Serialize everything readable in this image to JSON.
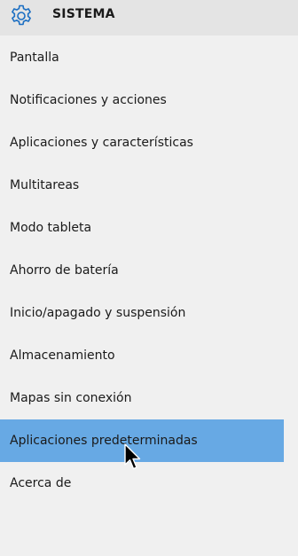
{
  "header": {
    "icon": "gear-icon",
    "title": "SISTEMA",
    "accent_color": "#1b6ec2"
  },
  "nav": {
    "selected_color": "#67a9e4",
    "items": [
      {
        "label": "Pantalla"
      },
      {
        "label": "Notificaciones y acciones"
      },
      {
        "label": "Aplicaciones y características"
      },
      {
        "label": "Multitareas"
      },
      {
        "label": "Modo tableta"
      },
      {
        "label": "Ahorro de batería"
      },
      {
        "label": "Inicio/apagado y suspensión"
      },
      {
        "label": "Almacenamiento"
      },
      {
        "label": "Mapas sin conexión"
      },
      {
        "label": "Aplicaciones predeterminadas",
        "selected": true
      },
      {
        "label": "Acerca de"
      }
    ]
  }
}
